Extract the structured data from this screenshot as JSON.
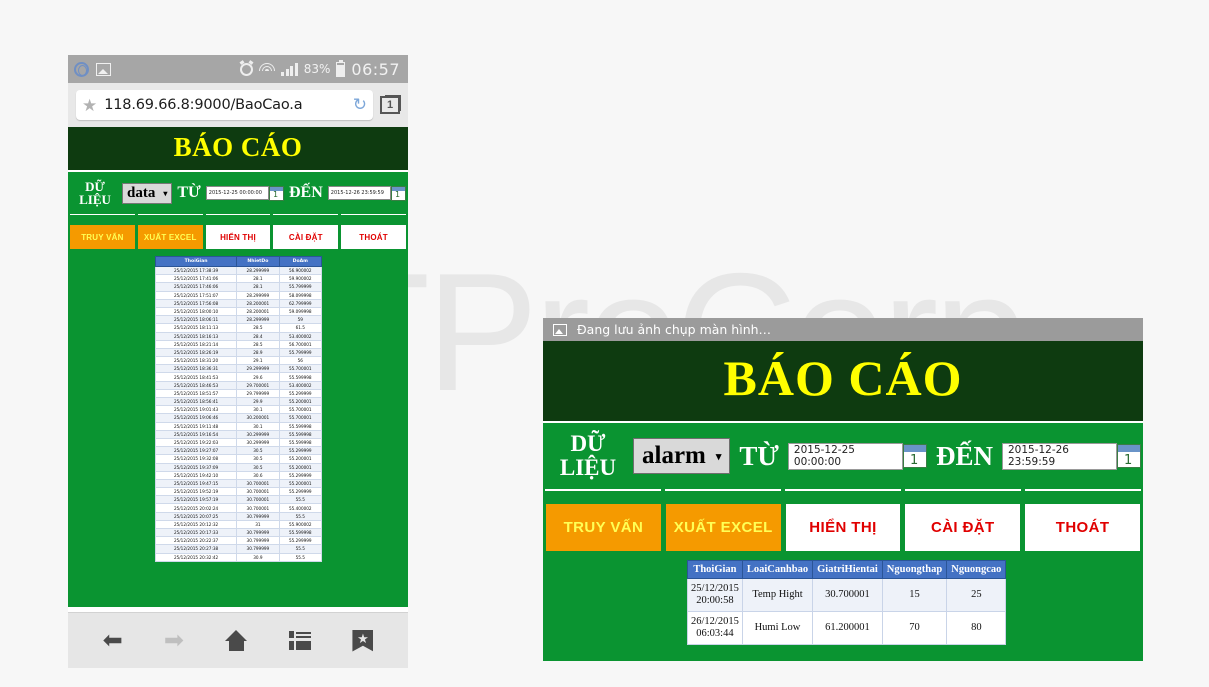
{
  "watermark": "ATProCorp",
  "phone": {
    "status_bar": {
      "opera_icon": "opera-browser-icon",
      "screenshot_icon": "screenshot-image-icon",
      "alarm_icon": "alarm-clock-icon",
      "wifi_icon": "wifi-icon",
      "signal_icon": "cell-signal-icon",
      "battery_percent": "83%",
      "battery_icon": "battery-icon",
      "clock": "06:57"
    },
    "url_bar": {
      "star_icon": "star-icon",
      "url": "118.69.66.8:9000/BaoCao.a",
      "reload_icon": "reload-icon",
      "tab_count": "1"
    },
    "page": {
      "title": "BÁO CÁO",
      "form": {
        "data_label": "DỮ LIỆU",
        "dataset_value": "data",
        "from_label": "TỪ",
        "from_value": "2015-12-25 00:00:00",
        "to_label": "ĐẾN",
        "to_value": "2015-12-26 23:59:59",
        "calendar_icon": "calendar-icon"
      },
      "buttons": [
        {
          "label": "TRUY VẤN",
          "style": "orange"
        },
        {
          "label": "XUẤT EXCEL",
          "style": "orange"
        },
        {
          "label": "HIỂN THỊ",
          "style": "white"
        },
        {
          "label": "CÀI ĐẶT",
          "style": "white"
        },
        {
          "label": "THOÁT",
          "style": "white"
        }
      ],
      "table": {
        "headers": [
          "ThoiGian",
          "NhietDo",
          "DoAm"
        ],
        "rows": [
          [
            "25/12/2015 17:38:39",
            "28.299999",
            "56.900002"
          ],
          [
            "25/12/2015 17:41:06",
            "28.1",
            "59.900002"
          ],
          [
            "25/12/2015 17:46:06",
            "28.1",
            "55.799999"
          ],
          [
            "25/12/2015 17:51:07",
            "28.299999",
            "58.099998"
          ],
          [
            "25/12/2015 17:56:08",
            "28.200001",
            "62.799999"
          ],
          [
            "25/12/2015 18:00:10",
            "28.200001",
            "59.099998"
          ],
          [
            "25/12/2015 18:06:11",
            "28.299999",
            "59"
          ],
          [
            "25/12/2015 18:11:13",
            "28.5",
            "61.5"
          ],
          [
            "25/12/2015 18:16:13",
            "28.4",
            "53.400002"
          ],
          [
            "25/12/2015 18:21:14",
            "28.5",
            "56.700001"
          ],
          [
            "25/12/2015 18:26:19",
            "28.9",
            "55.799999"
          ],
          [
            "25/12/2015 18:31:20",
            "29.1",
            "56"
          ],
          [
            "25/12/2015 18:36:31",
            "29.299999",
            "55.700001"
          ],
          [
            "25/12/2015 18:41:53",
            "29.6",
            "55.599998"
          ],
          [
            "25/12/2015 18:46:53",
            "29.700001",
            "53.400002"
          ],
          [
            "25/12/2015 18:51:57",
            "29.799999",
            "55.299999"
          ],
          [
            "25/12/2015 18:56:41",
            "29.9",
            "55.200001"
          ],
          [
            "25/12/2015 19:01:43",
            "30.1",
            "55.700001"
          ],
          [
            "25/12/2015 19:06:46",
            "30.200001",
            "55.700001"
          ],
          [
            "25/12/2015 19:11:48",
            "30.1",
            "55.599998"
          ],
          [
            "25/12/2015 19:16:54",
            "30.299999",
            "55.599998"
          ],
          [
            "25/12/2015 19:22:03",
            "30.299999",
            "55.599998"
          ],
          [
            "25/12/2015 19:27:07",
            "30.5",
            "55.299999"
          ],
          [
            "25/12/2015 19:32:08",
            "30.5",
            "55.200001"
          ],
          [
            "25/12/2015 19:37:09",
            "30.5",
            "55.200001"
          ],
          [
            "25/12/2015 19:42:10",
            "30.6",
            "55.299999"
          ],
          [
            "25/12/2015 19:47:15",
            "30.700001",
            "55.200001"
          ],
          [
            "25/12/2015 19:52:19",
            "30.700001",
            "55.299999"
          ],
          [
            "25/12/2015 19:57:19",
            "30.700001",
            "55.5"
          ],
          [
            "25/12/2015 20:02:24",
            "30.700001",
            "55.400002"
          ],
          [
            "25/12/2015 20:07:25",
            "30.799999",
            "55.5"
          ],
          [
            "25/12/2015 20:12:32",
            "31",
            "55.900002"
          ],
          [
            "25/12/2015 20:17:33",
            "30.799999",
            "55.599998"
          ],
          [
            "25/12/2015 20:22:37",
            "30.799999",
            "55.299999"
          ],
          [
            "25/12/2015 20:27:38",
            "30.799999",
            "55.5"
          ],
          [
            "25/12/2015 20:32:42",
            "30.9",
            "55.5"
          ]
        ]
      }
    },
    "nav": {
      "back_icon": "back-arrow-icon",
      "forward_icon": "forward-arrow-icon",
      "home_icon": "home-icon",
      "tabs_icon": "tabs-list-icon",
      "bookmark_icon": "bookmark-star-icon"
    }
  },
  "desktop": {
    "notification": {
      "icon": "screenshot-image-icon",
      "text": "Đang lưu ảnh chụp màn hình…"
    },
    "page": {
      "title": "BÁO CÁO",
      "form": {
        "data_label": "DỮ LIỆU",
        "dataset_value": "alarm",
        "from_label": "TỪ",
        "from_value": "2015-12-25 00:00:00",
        "to_label": "ĐẾN",
        "to_value": "2015-12-26 23:59:59",
        "calendar_icon": "calendar-icon"
      },
      "buttons": [
        {
          "label": "TRUY VẤN",
          "style": "orange"
        },
        {
          "label": "XUẤT EXCEL",
          "style": "orange"
        },
        {
          "label": "HIỂN THỊ",
          "style": "white"
        },
        {
          "label": "CÀI ĐẶT",
          "style": "white"
        },
        {
          "label": "THOÁT",
          "style": "white"
        }
      ],
      "table": {
        "headers": [
          "ThoiGian",
          "LoaiCanhbao",
          "GiatriHientai",
          "Nguongthap",
          "Nguongcao"
        ],
        "rows": [
          [
            "25/12/2015 20:00:58",
            "Temp Hight",
            "30.700001",
            "15",
            "25"
          ],
          [
            "26/12/2015 06:03:44",
            "Humi Low",
            "61.200001",
            "70",
            "80"
          ]
        ]
      }
    }
  },
  "colors": {
    "green": "#0a9431",
    "dark_green": "#0e3b10",
    "title_yellow": "#ffff00",
    "orange": "#f59a00",
    "btn_red": "#e00000",
    "table_header_blue": "#4472c4"
  }
}
